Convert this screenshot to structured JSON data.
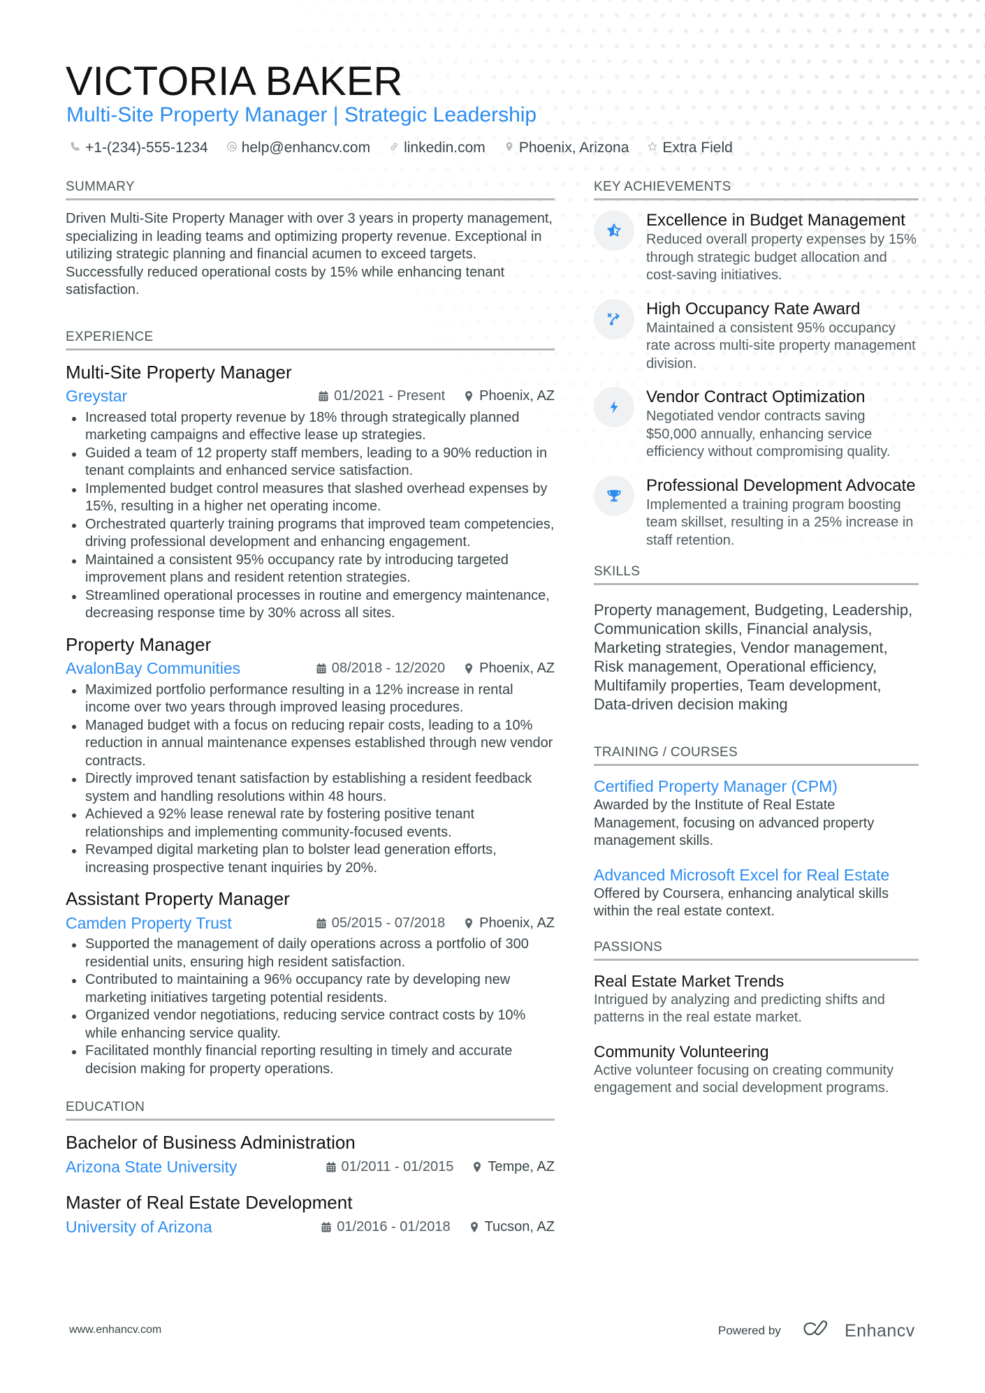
{
  "header": {
    "name": "VICTORIA BAKER",
    "headline": "Multi-Site Property Manager | Strategic Leadership",
    "contacts": [
      {
        "icon": "phone-icon",
        "text": "+1-(234)-555-1234"
      },
      {
        "icon": "at-icon",
        "text": "help@enhancv.com"
      },
      {
        "icon": "link-icon",
        "text": "linkedin.com"
      },
      {
        "icon": "location-icon",
        "text": "Phoenix, Arizona"
      },
      {
        "icon": "star-icon",
        "text": "Extra Field"
      }
    ]
  },
  "colors": {
    "accent": "#2b8cf0",
    "text": "#384347",
    "heading": "#111111",
    "rule": "#b3b7b9",
    "icon_bg": "#eff1f2"
  },
  "summary": {
    "title": "SUMMARY",
    "text": "Driven Multi-Site Property Manager with over 3 years in property management, specializing in leading teams and optimizing property revenue. Exceptional in utilizing strategic planning and financial acumen to exceed targets. Successfully reduced operational costs by 15% while enhancing tenant satisfaction."
  },
  "experience": {
    "title": "EXPERIENCE",
    "jobs": [
      {
        "role": "Multi-Site Property Manager",
        "company": "Greystar",
        "dates": "01/2021 - Present",
        "location": "Phoenix, AZ",
        "bullets": [
          "Increased total property revenue by 18% through strategically planned marketing campaigns and effective lease up strategies.",
          "Guided a team of 12 property staff members, leading to a 90% reduction in tenant complaints and enhanced service satisfaction.",
          "Implemented budget control measures that slashed overhead expenses by 15%, resulting in a higher net operating income.",
          "Orchestrated quarterly training programs that improved team competencies, driving professional development and enhancing engagement.",
          "Maintained a consistent 95% occupancy rate by introducing targeted improvement plans and resident retention strategies.",
          "Streamlined operational processes in routine and emergency maintenance, decreasing response time by 30% across all sites."
        ]
      },
      {
        "role": "Property Manager",
        "company": "AvalonBay Communities",
        "dates": "08/2018 - 12/2020",
        "location": "Phoenix, AZ",
        "bullets": [
          "Maximized portfolio performance resulting in a 12% increase in rental income over two years through improved leasing procedures.",
          "Managed budget with a focus on reducing repair costs, leading to a 10% reduction in annual maintenance expenses established through new vendor contracts.",
          "Directly improved tenant satisfaction by establishing a resident feedback system and handling resolutions within 48 hours.",
          "Achieved a 92% lease renewal rate by fostering positive tenant relationships and implementing community-focused events.",
          "Revamped digital marketing plan to bolster lead generation efforts, increasing prospective tenant inquiries by 20%."
        ]
      },
      {
        "role": "Assistant Property Manager",
        "company": "Camden Property Trust",
        "dates": "05/2015 - 07/2018",
        "location": "Phoenix, AZ",
        "bullets": [
          "Supported the management of daily operations across a portfolio of 300 residential units, ensuring high resident satisfaction.",
          "Contributed to maintaining a 96% occupancy rate by developing new marketing initiatives targeting potential residents.",
          "Organized vendor negotiations, reducing service contract costs by 10% while enhancing service quality.",
          "Facilitated monthly financial reporting resulting in timely and accurate decision making for property operations."
        ]
      }
    ]
  },
  "education": {
    "title": "EDUCATION",
    "items": [
      {
        "degree": "Bachelor of Business Administration",
        "school": "Arizona State University",
        "dates": "01/2011 - 01/2015",
        "location": "Tempe, AZ"
      },
      {
        "degree": "Master of Real Estate Development",
        "school": "University of Arizona",
        "dates": "01/2016 - 01/2018",
        "location": "Tucson, AZ"
      }
    ]
  },
  "achievements": {
    "title": "KEY ACHIEVEMENTS",
    "items": [
      {
        "icon": "star-half-icon",
        "title": "Excellence in Budget Management",
        "desc": "Reduced overall property expenses by 15% through strategic budget allocation and cost-saving initiatives."
      },
      {
        "icon": "strategy-icon",
        "title": "High Occupancy Rate Award",
        "desc": "Maintained a consistent 95% occupancy rate across multi-site property management division."
      },
      {
        "icon": "bolt-icon",
        "title": "Vendor Contract Optimization",
        "desc": "Negotiated vendor contracts saving $50,000 annually, enhancing service efficiency without compromising quality."
      },
      {
        "icon": "trophy-icon",
        "title": "Professional Development Advocate",
        "desc": "Implemented a training program boosting team skillset, resulting in a 25% increase in staff retention."
      }
    ]
  },
  "skills": {
    "title": "SKILLS",
    "text": "Property management, Budgeting, Leadership, Communication skills, Financial analysis, Marketing strategies, Vendor management, Risk management, Operational efficiency, Multifamily properties, Team development, Data-driven decision making"
  },
  "training": {
    "title": "TRAINING / COURSES",
    "items": [
      {
        "title": "Certified Property Manager (CPM)",
        "desc": "Awarded by the Institute of Real Estate Management, focusing on advanced property management skills."
      },
      {
        "title": "Advanced Microsoft Excel for Real Estate",
        "desc": "Offered by Coursera, enhancing analytical skills within the real estate context."
      }
    ]
  },
  "passions": {
    "title": "PASSIONS",
    "items": [
      {
        "title": "Real Estate Market Trends",
        "desc": "Intrigued by analyzing and predicting shifts and patterns in the real estate market."
      },
      {
        "title": "Community Volunteering",
        "desc": "Active volunteer focusing on creating community engagement and social development programs."
      }
    ]
  },
  "footer": {
    "url": "www.enhancv.com",
    "powered_by": "Powered by",
    "brand": "Enhancv"
  }
}
